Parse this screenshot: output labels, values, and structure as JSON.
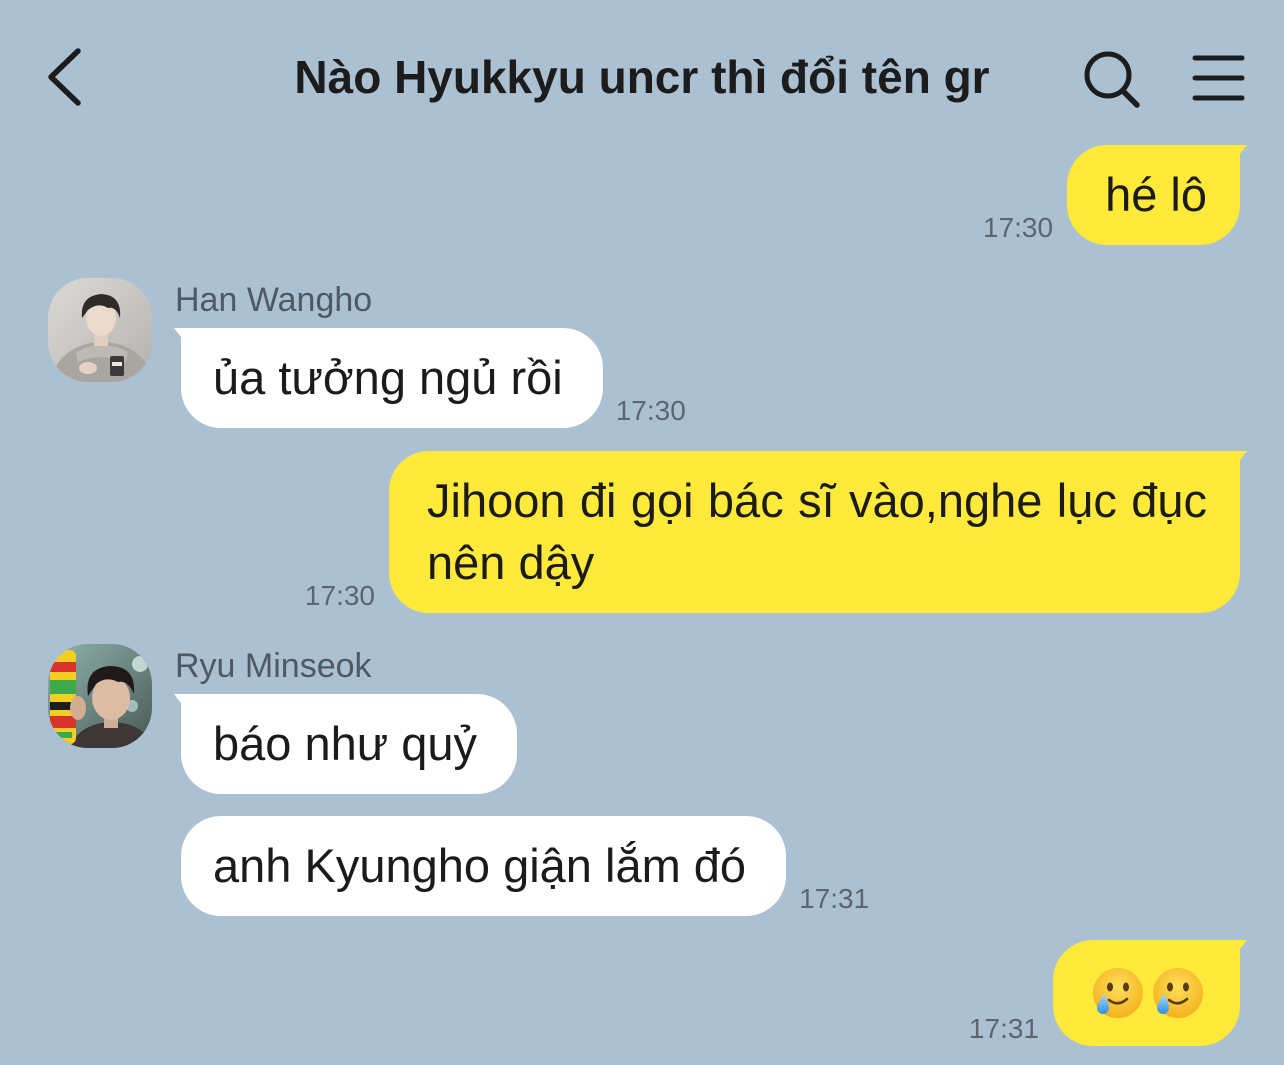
{
  "header": {
    "title": "Nào Hyukkyu uncr thì đổi tên gr",
    "back_icon": "chevron-left-icon",
    "search_icon": "search-icon",
    "menu_icon": "hamburger-menu-icon"
  },
  "colors": {
    "chat_background": "#abc1d2",
    "sent_bubble": "#ffe93b",
    "received_bubble": "#ffffff",
    "timestamp": "#5b6671",
    "sender_name": "#4e5964",
    "message_text": "#1b1b1b"
  },
  "chat": [
    {
      "sent": [
        {
          "text": "hé lô",
          "time": "17:30"
        }
      ]
    },
    {
      "sender": "Han Wangho",
      "avatar_icon": "profile-photo-icon",
      "received": [
        {
          "text": "ủa tưởng ngủ rồi",
          "time": "17:30"
        }
      ]
    },
    {
      "sent": [
        {
          "text": "Jihoon đi gọi bác sĩ vào,nghe lục đục nên dậy",
          "time": "17:30"
        }
      ]
    },
    {
      "sender": "Ryu Minseok",
      "avatar_icon": "profile-photo-icon",
      "received": [
        {
          "text": "báo như quỷ"
        },
        {
          "text": "anh Kyungho giận lắm đó",
          "time": "17:31"
        }
      ]
    },
    {
      "sent": [
        {
          "emoji_icons": [
            "smiling-face-with-tear-icon",
            "smiling-face-with-tear-icon"
          ],
          "time": "17:31"
        }
      ]
    }
  ]
}
